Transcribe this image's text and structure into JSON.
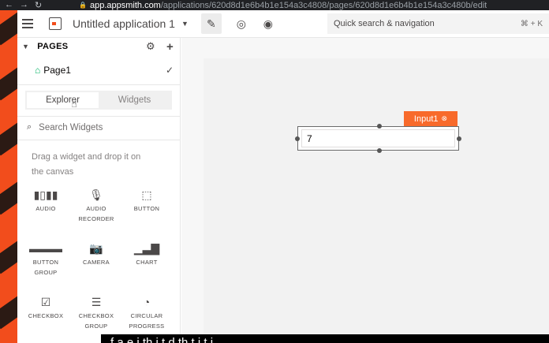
{
  "browser": {
    "nav_icons": [
      "back-arrow-icon",
      "forward-arrow-icon",
      "reload-icon"
    ],
    "url_host": "app.appsmith.com",
    "url_path": "/applications/620d8d1e6b4b1e154a3c4808/pages/620d8d1e6b4b1e154a3c480b/edit"
  },
  "header": {
    "app_name": "Untitled application 1",
    "search_label": "Quick search & navigation",
    "search_shortcut": "⌘ + K"
  },
  "sidebar": {
    "pages_title": "PAGES",
    "page_name": "Page1",
    "tabs": {
      "explorer": "Explorer",
      "widgets": "Widgets"
    },
    "search_placeholder": "Search Widgets",
    "hint_line1": "Drag a widget and drop it on",
    "hint_line2": "the canvas",
    "widgets": [
      {
        "glyph": "▮▯▮▮",
        "label1": "AUDIO",
        "label2": "",
        "icon": "audio-icon"
      },
      {
        "glyph": "🎙",
        "label1": "AUDIO",
        "label2": "RECORDER",
        "icon": "microphone-icon"
      },
      {
        "glyph": "⬚",
        "label1": "BUTTON",
        "label2": "",
        "icon": "button-icon"
      },
      {
        "glyph": "▬▬▬",
        "label1": "BUTTON",
        "label2": "GROUP",
        "icon": "button-group-icon"
      },
      {
        "glyph": "📷",
        "label1": "CAMERA",
        "label2": "",
        "icon": "camera-icon"
      },
      {
        "glyph": "▁▃▇",
        "label1": "CHART",
        "label2": "",
        "icon": "chart-icon"
      },
      {
        "glyph": "☑",
        "label1": "CHECKBOX",
        "label2": "",
        "icon": "checkbox-icon"
      },
      {
        "glyph": "☰",
        "label1": "CHECKBOX",
        "label2": "GROUP",
        "icon": "checkbox-group-icon"
      },
      {
        "glyph": "◔",
        "label1": "CIRCULAR",
        "label2": "PROGRESS",
        "icon": "circular-progress-icon"
      }
    ]
  },
  "canvas": {
    "widget_name": "Input1",
    "input_value": "7"
  },
  "colors": {
    "accent": "#f86a2b",
    "home_icon": "#03b365"
  },
  "subtitle": "f                     a            e               i   th    i     t           d th t i    t i"
}
